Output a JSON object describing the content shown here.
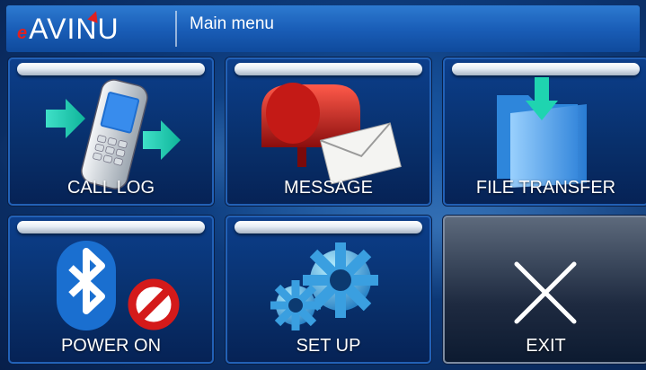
{
  "header": {
    "logo_e": "e",
    "logo_text": "AVINU",
    "title": "Main menu"
  },
  "tiles": [
    {
      "label": "CALL LOG",
      "icon": "phone-icon"
    },
    {
      "label": "MESSAGE",
      "icon": "mailbox-icon"
    },
    {
      "label": "FILE TRANSFER",
      "icon": "folder-icon"
    },
    {
      "label": "POWER ON",
      "icon": "bluetooth-icon"
    },
    {
      "label": "SET UP",
      "icon": "gears-icon"
    },
    {
      "label": "EXIT",
      "icon": "close-icon"
    }
  ],
  "colors": {
    "accent_blue": "#1a5eb8",
    "logo_red": "#e02020",
    "tile_blue": "#0c3f8c"
  }
}
